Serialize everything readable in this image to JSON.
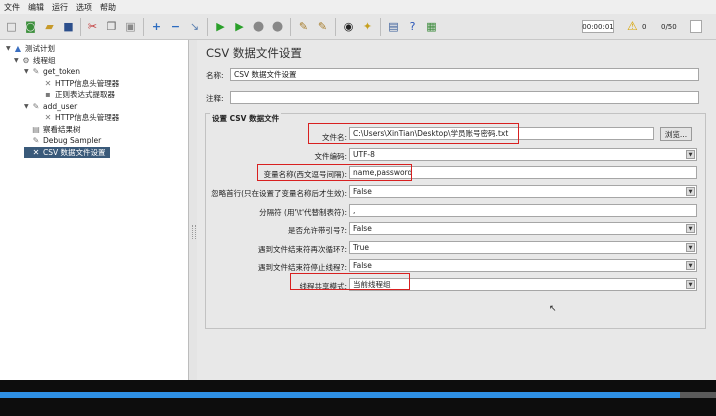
{
  "menu": [
    "文件",
    "编辑",
    "运行",
    "选项",
    "帮助"
  ],
  "toolbar": {
    "timer": "00:00:01",
    "warning_count": "0",
    "threads": "0/50"
  },
  "tree": [
    {
      "label": "测试计划",
      "level": 0,
      "expanded": true,
      "icon": "test-plan-icon",
      "glyph": "▲"
    },
    {
      "label": "线程组",
      "level": 1,
      "expanded": true,
      "icon": "gear-icon",
      "glyph": "⚙"
    },
    {
      "label": "get_token",
      "level": 2,
      "expanded": true,
      "icon": "pen-icon",
      "glyph": "✎"
    },
    {
      "label": "HTTP信息头管理器",
      "level": 3,
      "icon": "wrench-icon",
      "glyph": "✕"
    },
    {
      "label": "正则表达式提取器",
      "level": 3,
      "icon": "tag-icon",
      "glyph": "▪"
    },
    {
      "label": "add_user",
      "level": 2,
      "expanded": true,
      "icon": "pen-icon",
      "glyph": "✎"
    },
    {
      "label": "HTTP信息头管理器",
      "level": 3,
      "icon": "wrench-icon",
      "glyph": "✕"
    },
    {
      "label": "察看结果树",
      "level": 2,
      "icon": "chart-icon",
      "glyph": "▤"
    },
    {
      "label": "Debug Sampler",
      "level": 2,
      "icon": "pen-icon",
      "glyph": "✎"
    },
    {
      "label": "CSV 数据文件设置",
      "level": 2,
      "icon": "wrench-icon",
      "glyph": "✕",
      "selected": true
    }
  ],
  "main": {
    "title": "CSV 数据文件设置",
    "name_label": "名称:",
    "name_value": "CSV 数据文件设置",
    "comment_label": "注释:",
    "comment_value": "",
    "group_title": "设置 CSV 数据文件",
    "filename_label": "文件名:",
    "filename_value": "C:\\Users\\XinTian\\Desktop\\学员账号密码.txt",
    "browse_label": "浏览...",
    "encoding_label": "文件编码:",
    "encoding_value": "UTF-8",
    "varnames_label": "变量名称(西文逗号间隔):",
    "varnames_value": "name,password",
    "ignore_first_label": "忽略首行(只在设置了变量名称后才生效):",
    "ignore_first_value": "False",
    "delimiter_label": "分隔符 (用'\\t'代替制表符):",
    "delimiter_value": ",",
    "quoted_label": "是否允许带引号?:",
    "quoted_value": "False",
    "recycle_label": "遇到文件结束符再次循环?:",
    "recycle_value": "True",
    "stop_label": "遇到文件结束符停止线程?:",
    "stop_value": "False",
    "sharing_label": "线程共享模式:",
    "sharing_value": "当前线程组"
  },
  "colors": {
    "highlight": "#d82020",
    "selection": "#3a5a7a",
    "progress": "#2e8fe3"
  },
  "video_progress": 0.95
}
